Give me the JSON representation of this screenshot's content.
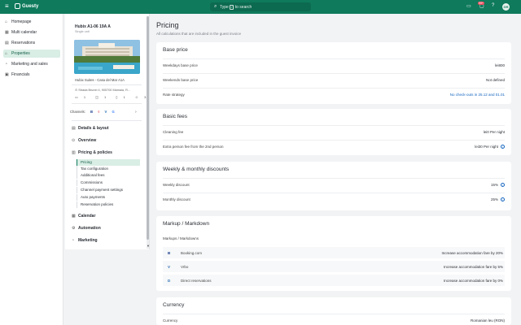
{
  "topbar": {
    "logo_text": "Guesty",
    "search_prefix": "Type",
    "search_key": "/",
    "search_suffix": "to search",
    "notification_count": "99+",
    "avatar_initials": "GR"
  },
  "nav": {
    "items": [
      {
        "label": "Homepage",
        "icon": "home-icon"
      },
      {
        "label": "Multi calendar",
        "icon": "calendar-icon"
      },
      {
        "label": "Reservations",
        "icon": "reservations-icon"
      },
      {
        "label": "Properties",
        "icon": "properties-icon",
        "active": true
      },
      {
        "label": "Marketing and sales",
        "icon": "marketing-icon"
      },
      {
        "label": "Financials",
        "icon": "financials-icon"
      }
    ]
  },
  "listing": {
    "title": "Hubix A1-06 19A A",
    "subtitle": "Single unit",
    "name": "Hubix Suites - Casa del Mar A1A",
    "address": "Strada Brunei 4, 905700 Mamaia, R...",
    "stats": {
      "bedrooms": "1",
      "bathrooms": "1",
      "beds": "1",
      "guests": "3"
    },
    "channels_label": "Channels:"
  },
  "sections": {
    "details": "Details & layout",
    "overview": "Overview",
    "pricing": "Pricing & policies",
    "pricing_items": [
      "Pricing",
      "Tax configuration",
      "Additional fees",
      "Commissions",
      "Channel payment settings",
      "Auto payments",
      "Reservation policies"
    ],
    "calendar": "Calendar",
    "automation": "Automation",
    "marketing": "Marketing"
  },
  "main": {
    "title": "Pricing",
    "subtitle": "All calculations that are included in the guest invoice",
    "base_price": {
      "heading": "Base price",
      "rows": [
        {
          "label": "Weekdays base price",
          "value": "lei800"
        },
        {
          "label": "Weekends base price",
          "value": "Not defined"
        },
        {
          "label": "Rate strategy",
          "value": "No check-outs in 25.12 and 01.01"
        }
      ]
    },
    "basic_fees": {
      "heading": "Basic fees",
      "rows": [
        {
          "label": "Cleaning fee",
          "value": "lei0 Per night"
        },
        {
          "label": "Extra person fee from the 2nd person",
          "value": "lei30 Per night"
        }
      ]
    },
    "discounts": {
      "heading": "Weekly & monthly discounts",
      "rows": [
        {
          "label": "Weekly discount",
          "value": "15%"
        },
        {
          "label": "Monthly discount",
          "value": "25%"
        }
      ]
    },
    "markup": {
      "heading": "Markup / Markdown",
      "label": "Markups / Markdowns",
      "rows": [
        {
          "icon": "B",
          "channel": "Booking.com",
          "value": "Increase accommodation fare by 20%"
        },
        {
          "icon": "V",
          "channel": "Vrbo",
          "value": "Increase accommodation fare by 5%"
        },
        {
          "icon": "D",
          "channel": "Direct reservations",
          "value": "Increase accommodation fare by 0%"
        }
      ]
    },
    "currency": {
      "heading": "Currency",
      "label": "Currency",
      "value": "Romanian leu (RON)"
    }
  },
  "colors": {
    "brand": "#0f7a5c",
    "active_bg": "#d9eee5",
    "link": "#1565c0"
  }
}
